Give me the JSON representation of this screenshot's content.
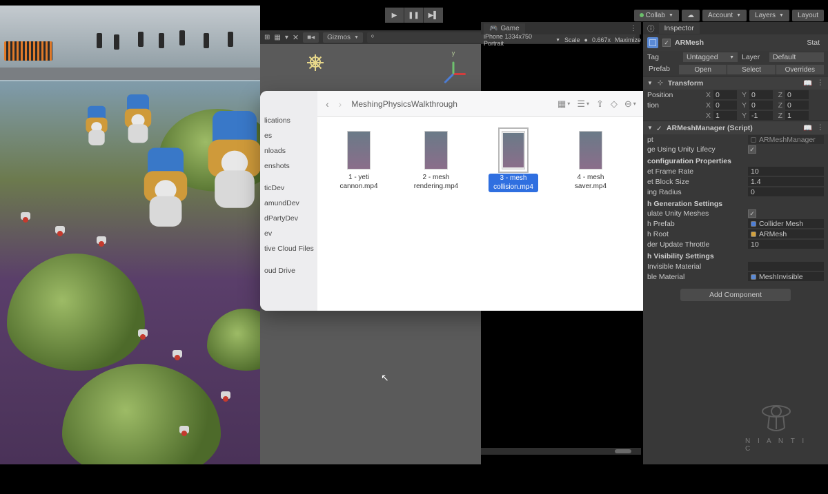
{
  "toolbar": {
    "collab": "Collab",
    "account": "Account",
    "layers": "Layers",
    "layout": "Layout"
  },
  "scene_toolbar": {
    "gizmos": "Gizmos"
  },
  "game": {
    "tab": "Game",
    "display": "iPhone 1334x750 Portrait",
    "scale_label": "Scale",
    "scale_value": "0.667x",
    "maximize": "Maximize"
  },
  "finder": {
    "title": "MeshingPhysicsWalkthrough",
    "sidebar": [
      "lications",
      "es",
      "nloads",
      "enshots",
      "",
      "ticDev",
      "amundDev",
      "dPartyDev",
      "ev",
      "tive Cloud Files",
      "",
      "oud Drive"
    ],
    "files": [
      {
        "name": "1 - yeti cannon.mp4"
      },
      {
        "name": "2 - mesh rendering.mp4"
      },
      {
        "name": "3 - mesh collision.mp4",
        "selected": true
      },
      {
        "name": "4 - mesh saver.mp4"
      }
    ]
  },
  "inspector": {
    "tab": "Inspector",
    "object_name": "ARMesh",
    "static": "Stat",
    "tag_label": "Tag",
    "tag_value": "Untagged",
    "layer_label": "Layer",
    "layer_value": "Default",
    "prefab_label": "Prefab",
    "prefab_open": "Open",
    "prefab_select": "Select",
    "prefab_overrides": "Overrides",
    "transform": {
      "title": "Transform",
      "position": "Position",
      "px": "0",
      "py": "0",
      "pz": "0",
      "rotation_x": "0",
      "rotation_y": "0",
      "rotation_z": "0",
      "scale": "",
      "sx": "1",
      "sy": "-1",
      "sz": "1"
    },
    "armesh": {
      "title": "ARMeshManager (Script)",
      "script_label": "pt",
      "script_value": "ARMeshManager",
      "lifecycle_label": "ge Using Unity Lifecy",
      "config_header": "configuration Properties",
      "frame_rate_label": "et Frame Rate",
      "frame_rate": "10",
      "block_size_label": "et Block Size",
      "block_size": "1.4",
      "radius_label": "ing Radius",
      "radius": "0",
      "gen_header": "h Generation Settings",
      "unity_meshes_label": "ulate Unity Meshes",
      "prefab_label": "h Prefab",
      "prefab_value": "Collider Mesh",
      "root_label": "h Root",
      "root_value": "ARMesh",
      "throttle_label": "der Update Throttle",
      "throttle": "10",
      "vis_header": "h Visibility Settings",
      "inv_mat_label": "Invisible Material",
      "vis_mat_label": "ble Material",
      "vis_mat_value": "MeshInvisible"
    },
    "add_component": "Add Component"
  },
  "logo": "N I A N T I C"
}
